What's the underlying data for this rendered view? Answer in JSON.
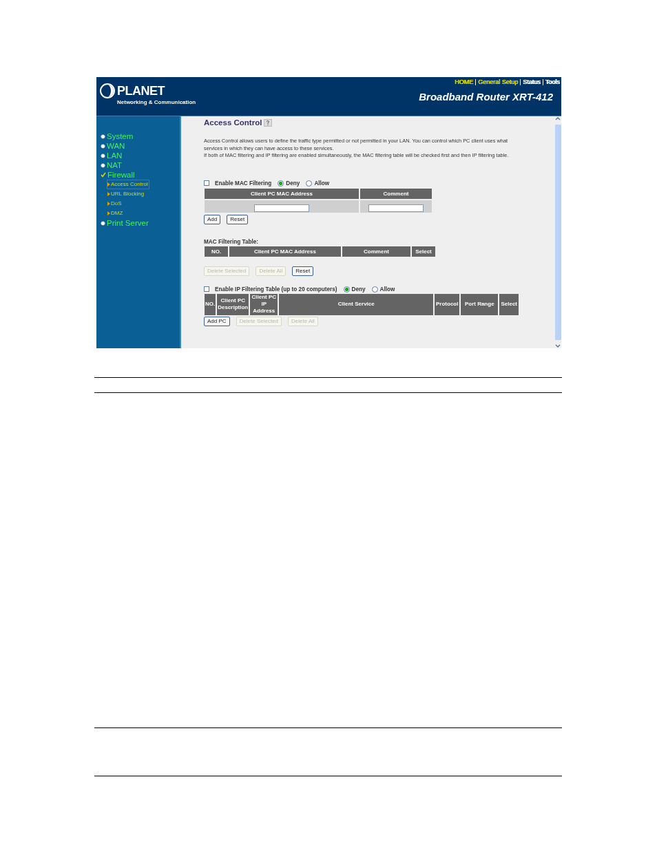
{
  "header": {
    "logo_text": "PLANET",
    "logo_tagline": "Networking & Communication",
    "product_title": "Broadband Router XRT-412",
    "nav_links": [
      {
        "label": "HOME",
        "color": "#d4d400"
      },
      {
        "label": "General Setup",
        "color": "#d4d400"
      },
      {
        "label": "Status",
        "color": "#ffffff"
      },
      {
        "label": "Tools",
        "color": "#ffffff"
      }
    ]
  },
  "sidebar": {
    "items": [
      {
        "label": "System",
        "kind": "bullet"
      },
      {
        "label": "WAN",
        "kind": "bullet"
      },
      {
        "label": "LAN",
        "kind": "bullet"
      },
      {
        "label": "NAT",
        "kind": "bullet"
      },
      {
        "label": "Firewall",
        "kind": "check",
        "children": [
          {
            "label": "Access Control",
            "selected": true
          },
          {
            "label": "URL Blocking",
            "selected": false
          },
          {
            "label": "DoS",
            "selected": false
          },
          {
            "label": "DMZ",
            "selected": false
          }
        ]
      },
      {
        "label": "Print Server",
        "kind": "bullet"
      }
    ]
  },
  "content": {
    "title": "Access Control",
    "description": [
      "Access Control allows users to define the traffic type permitted or not permitted in your LAN. You can control which PC client uses what services in which they can have access to these services.",
      "If both of MAC filtering and IP filtering are enabled simultaneously, the MAC filtering table will be checked first and then IP filtering table."
    ],
    "mac_filter": {
      "enable_label": "Enable MAC Filtering",
      "checked": false,
      "options": [
        {
          "label": "Deny",
          "selected": true
        },
        {
          "label": "Allow",
          "selected": false
        }
      ],
      "columns": [
        "Client PC MAC Address",
        "Comment"
      ],
      "buttons": [
        {
          "label": "Add",
          "disabled": false
        },
        {
          "label": "Reset",
          "disabled": false
        }
      ]
    },
    "mac_table": {
      "title": "MAC Filtering Table:",
      "columns": [
        "NO.",
        "Client PC MAC Address",
        "Comment",
        "Select"
      ],
      "buttons": [
        {
          "label": "Delete Selected",
          "disabled": true
        },
        {
          "label": "Delete All",
          "disabled": true
        },
        {
          "label": "Reset",
          "disabled": false
        }
      ]
    },
    "ip_filter": {
      "enable_label": "Enable IP Filtering Table (up to 20 computers)",
      "checked": false,
      "options": [
        {
          "label": "Deny",
          "selected": true
        },
        {
          "label": "Allow",
          "selected": false
        }
      ],
      "columns": [
        "NO.",
        "Client PC Description",
        "Client PC IP Address",
        "Client Service",
        "Protocol",
        "Port Range",
        "Select"
      ],
      "buttons": [
        {
          "label": "Add PC",
          "disabled": false
        },
        {
          "label": "Delete Selected",
          "disabled": true
        },
        {
          "label": "Delete All",
          "disabled": true
        }
      ]
    }
  }
}
